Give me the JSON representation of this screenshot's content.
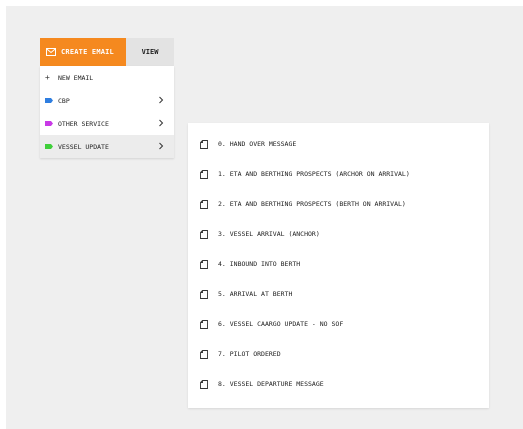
{
  "menubar": {
    "create_email_label": "CREATE EMAIL",
    "view_label": "VIEW"
  },
  "dropdown": {
    "items": [
      {
        "label": "NEW EMAIL",
        "prefix": "+"
      },
      {
        "label": "CBP",
        "tag_color": "#2f7ee0",
        "has_submenu": true
      },
      {
        "label": "OTHER SERVICE",
        "tag_color": "#c83ae6",
        "has_submenu": true
      },
      {
        "label": "VESSEL UPDATE",
        "tag_color": "#3fcf3a",
        "has_submenu": true,
        "active": true
      }
    ]
  },
  "submenu": {
    "items": [
      {
        "label": "0. HAND OVER MESSAGE"
      },
      {
        "label": "1. ETA AND BERTHING PROSPECTS (ARCHOR ON ARRIVAL)"
      },
      {
        "label": "2. ETA AND BERTHING PROSPECTS (BERTH ON ARRIVAL)"
      },
      {
        "label": "3. VESSEL ARRIVAL (ANCHOR)"
      },
      {
        "label": "4. INBOUND INTO BERTH"
      },
      {
        "label": "5. ARRIVAL AT BERTH"
      },
      {
        "label": "6. VESSEL CAARGO UPDATE - NO SOF"
      },
      {
        "label": "7. PILOT ORDERED"
      },
      {
        "label": "8. VESSEL DEPARTURE MESSAGE"
      }
    ]
  },
  "colors": {
    "accent": "#f5891f"
  }
}
